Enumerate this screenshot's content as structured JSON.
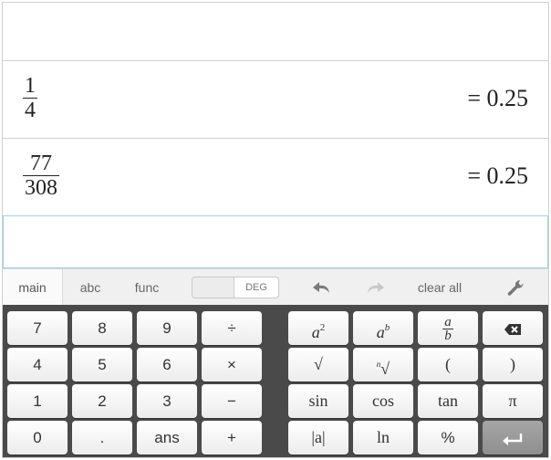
{
  "expressions": [
    {
      "numerator": "",
      "denominator": "",
      "result": ""
    },
    {
      "numerator": "1",
      "denominator": "4",
      "result": "= 0.25"
    },
    {
      "numerator": "77",
      "denominator": "308",
      "result": "= 0.25"
    }
  ],
  "toolbar": {
    "tabs": [
      "main",
      "abc",
      "func"
    ],
    "angle_mode": "DEG",
    "clear_all": "clear all",
    "icons": [
      "undo-icon",
      "redo-icon",
      "wrench-icon"
    ]
  },
  "keypad": {
    "left": [
      [
        "7",
        "8",
        "9",
        "÷"
      ],
      [
        "4",
        "5",
        "6",
        "×"
      ],
      [
        "1",
        "2",
        "3",
        "−"
      ],
      [
        "0",
        ".",
        "ans",
        "+"
      ]
    ],
    "right": {
      "row1": {
        "square_base": "a",
        "square_exp": "2",
        "power_base": "a",
        "power_exp": "b",
        "fraction_num": "a",
        "fraction_den": "b",
        "backspace_icon": "backspace-icon"
      },
      "row2": {
        "sqrt": "√",
        "nth_index": "n",
        "nth_root": "√",
        "open_paren": "(",
        "close_paren": ")"
      },
      "row3": [
        "sin",
        "cos",
        "tan",
        "π"
      ],
      "row4": {
        "abs": "|a|",
        "ln": "ln",
        "percent": "%",
        "enter_icon": "enter-icon"
      }
    }
  },
  "colors": {
    "keypad_bg": "#4a4a4a",
    "active_border": "#9fd1e6",
    "enter_key": "#9a9a9a"
  }
}
